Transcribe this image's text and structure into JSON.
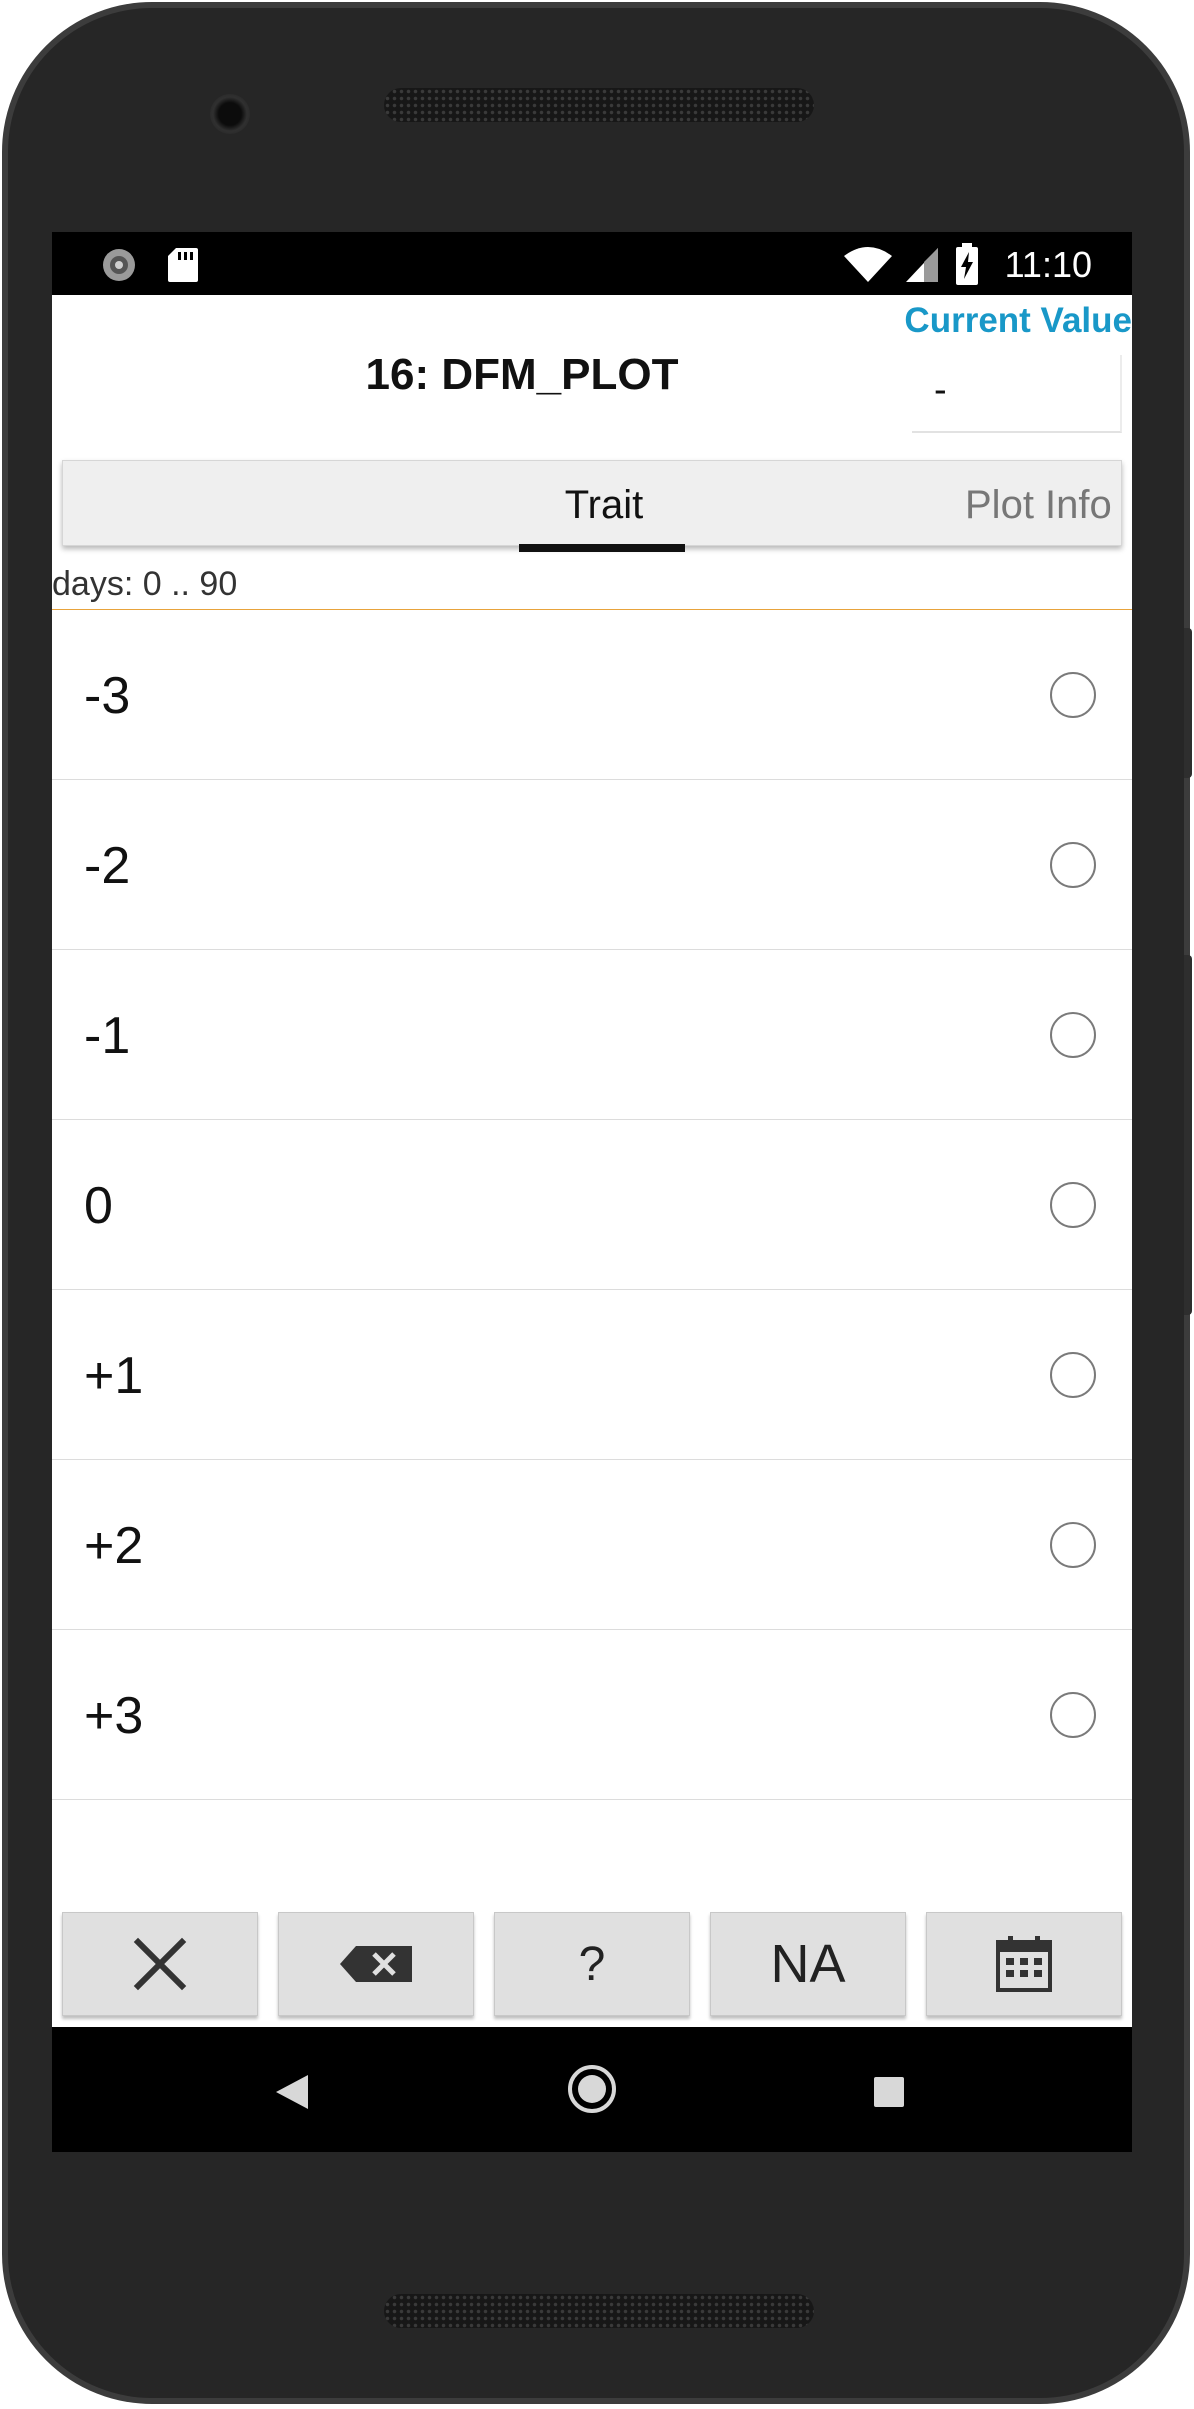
{
  "status_bar": {
    "time": "11:10",
    "left_icons": [
      "sync-icon",
      "sd-card-icon"
    ],
    "right_icons": [
      "wifi-icon",
      "signal-icon",
      "battery-charging-icon"
    ]
  },
  "header": {
    "plot_title": "16: DFM_PLOT",
    "current_value_label": "Current Value",
    "current_value": "-"
  },
  "tabs": [
    {
      "label": "Trait",
      "selected": true
    },
    {
      "label": "Plot Info",
      "selected": false
    }
  ],
  "trait_range": "days: 0 .. 90",
  "options": [
    {
      "label": "-3",
      "checked": false
    },
    {
      "label": "-2",
      "checked": false
    },
    {
      "label": "-1",
      "checked": false
    },
    {
      "label": "0",
      "checked": false
    },
    {
      "label": "+1",
      "checked": false
    },
    {
      "label": "+2",
      "checked": false
    },
    {
      "label": "+3",
      "checked": false
    }
  ],
  "bottom_buttons": {
    "clear_icon": "close-icon",
    "delete_icon": "backspace-icon",
    "help_label": "?",
    "na_label": "NA",
    "calendar_icon": "calendar-icon"
  },
  "nav_bar": [
    "back-icon",
    "home-icon",
    "recents-icon"
  ],
  "colors": {
    "accent": "#1998c8",
    "divider": "#e8a33b",
    "tab_indicator": "#111111"
  }
}
